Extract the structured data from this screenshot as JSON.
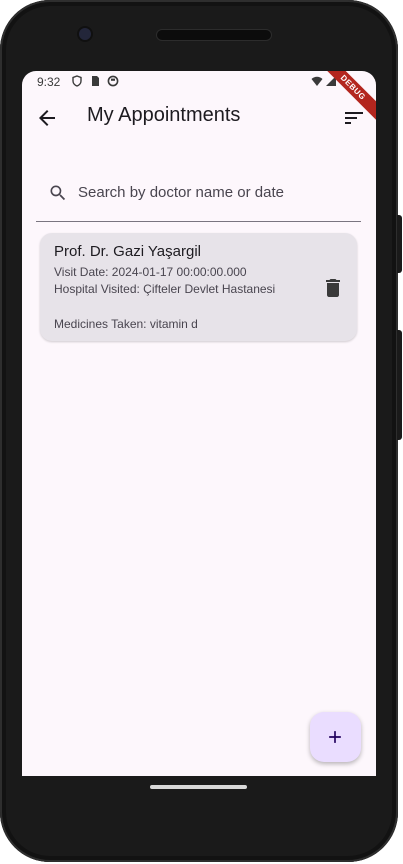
{
  "status_bar": {
    "time": "9:32",
    "icons": [
      "shield-icon",
      "sim-card-icon",
      "circle-app-icon"
    ],
    "right_icons": [
      "wifi-icon",
      "signal-icon"
    ],
    "debug_label": "DEBUG"
  },
  "app_bar": {
    "title": "My Appointments",
    "back_icon": "arrow-back-icon",
    "sort_icon": "sort-icon"
  },
  "search": {
    "placeholder": "Search by doctor name or date",
    "value": "",
    "icon": "search-icon"
  },
  "appointments": [
    {
      "doctor": "Prof. Dr. Gazi Yaşargil",
      "visit_date": "Visit Date: 2024-01-17 00:00:00.000",
      "hospital": "Hospital Visited: Çifteler Devlet Hastanesi",
      "medicines": "Medicines Taken: vitamin d",
      "action_icon": "delete-icon"
    }
  ],
  "fab": {
    "icon": "add-icon"
  },
  "colors": {
    "background": "#fdf7fc",
    "card": "#e7e3e9",
    "fab": "#eaddff",
    "debug_ribbon": "#b3261e",
    "text_primary": "#1d1b20",
    "text_secondary": "#49454f"
  }
}
